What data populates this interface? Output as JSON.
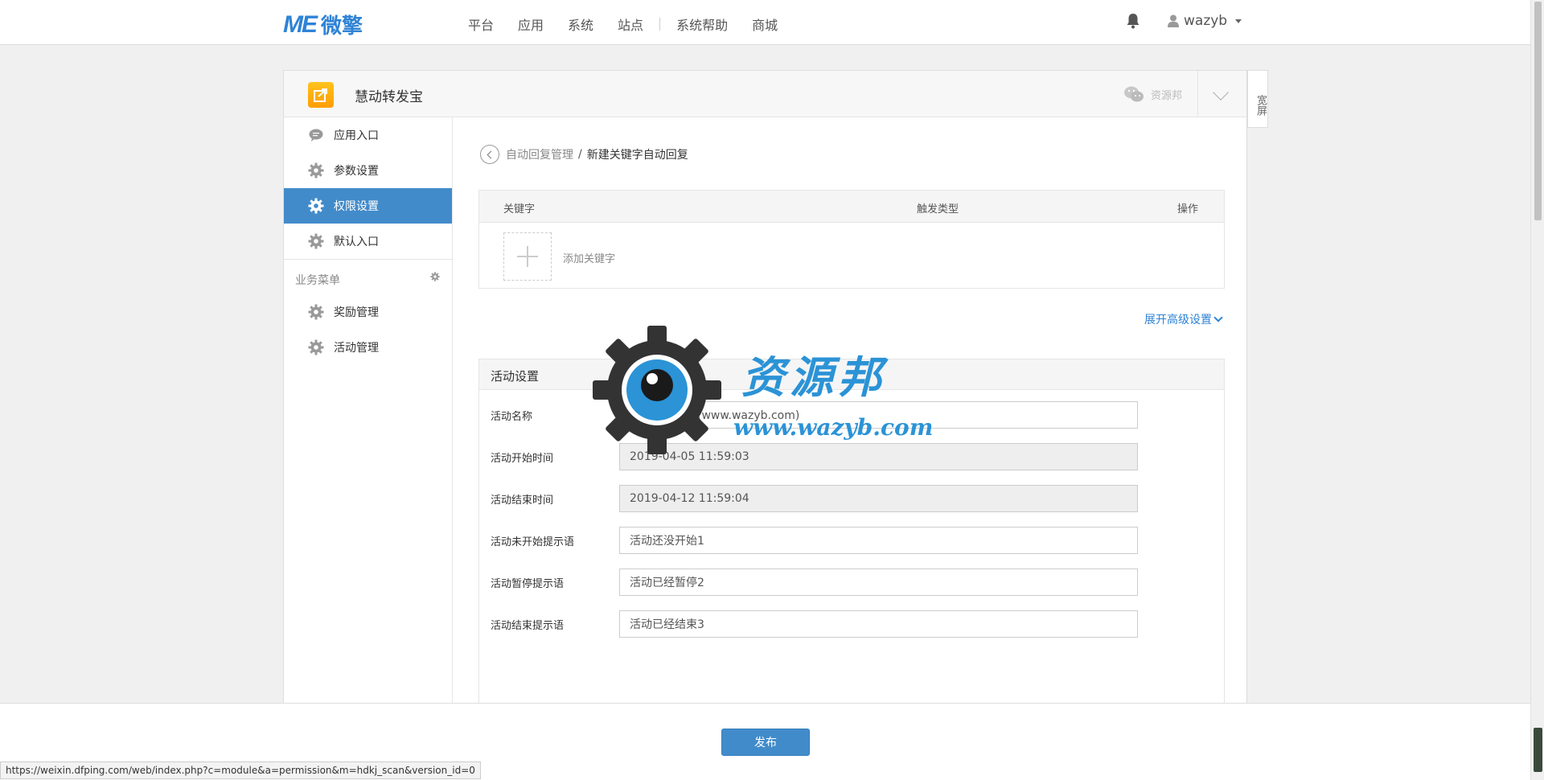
{
  "brand": {
    "mark": "ME",
    "name": "微擎",
    "color": "#2e83d6"
  },
  "nav": {
    "items": [
      "平台",
      "应用",
      "系统",
      "站点",
      "系统帮助",
      "商城"
    ]
  },
  "user": {
    "name": "wazyb"
  },
  "app": {
    "name": "慧动转发宝",
    "account": "资源邦",
    "wide_label": "宽屏"
  },
  "sidebar": {
    "items": [
      {
        "label": "应用入口",
        "icon": "comment-icon"
      },
      {
        "label": "参数设置",
        "icon": "gear-icon"
      },
      {
        "label": "权限设置",
        "icon": "gear-icon",
        "active": true
      },
      {
        "label": "默认入口",
        "icon": "gear-icon"
      }
    ],
    "section_title": "业务菜单",
    "section_items": [
      {
        "label": "奖励管理",
        "icon": "gear-icon"
      },
      {
        "label": "活动管理",
        "icon": "gear-icon"
      }
    ]
  },
  "breadcrumb": {
    "parent": "自动回复管理",
    "separator": "/",
    "current": "新建关键字自动回复"
  },
  "keyword_table": {
    "columns": [
      "关键字",
      "触发类型",
      "操作"
    ],
    "add_label": "添加关键字"
  },
  "advanced_label": "展开高级设置",
  "activity": {
    "title": "活动设置",
    "fields": [
      {
        "label": "活动名称",
        "value": "资源邦源码网(www.wazyb.com)",
        "readonly": false
      },
      {
        "label": "活动开始时间",
        "value": "2019-04-05 11:59:03",
        "readonly": true
      },
      {
        "label": "活动结束时间",
        "value": "2019-04-12 11:59:04",
        "readonly": true
      },
      {
        "label": "活动未开始提示语",
        "value": "活动还没开始1",
        "readonly": false
      },
      {
        "label": "活动暂停提示语",
        "value": "活动已经暂停2",
        "readonly": false
      },
      {
        "label": "活动结束提示语",
        "value": "活动已经结束3",
        "readonly": false
      }
    ]
  },
  "watermark": {
    "title": "资源邦",
    "url": "www.wazyb.com"
  },
  "publish_label": "发布",
  "status_url": "https://weixin.dfping.com/web/index.php?c=module&a=permission&m=hdkj_scan&version_id=0"
}
